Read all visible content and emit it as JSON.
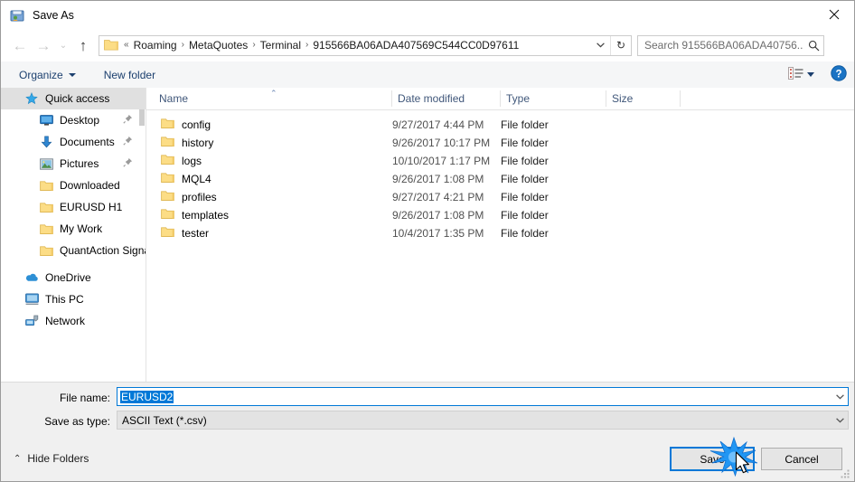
{
  "window": {
    "title": "Save As",
    "icon": "save-as-icon",
    "close_label": "✕"
  },
  "nav": {
    "back": "←",
    "forward": "→",
    "recent": "⌄",
    "up": "↑",
    "breadcrumb_prefix": "«",
    "crumbs": [
      "Roaming",
      "MetaQuotes",
      "Terminal",
      "915566BA06ADA407569C544CC0D97611"
    ],
    "separator": "›",
    "dropdown": "⌄",
    "refresh": "↻"
  },
  "search": {
    "placeholder": "Search 915566BA06ADA40756...",
    "icon": "search-icon"
  },
  "toolbar": {
    "organize": "Organize",
    "new_folder": "New folder",
    "view_icon": "view-layout-icon",
    "help_icon": "help-icon"
  },
  "sidebar": {
    "items": [
      {
        "label": "Quick access",
        "icon": "quick-access-star-icon",
        "selected": true,
        "indent": 0,
        "pinned": false
      },
      {
        "label": "Desktop",
        "icon": "desktop-icon",
        "selected": false,
        "indent": 1,
        "pinned": true
      },
      {
        "label": "Documents",
        "icon": "documents-down-arrow-icon",
        "selected": false,
        "indent": 1,
        "pinned": true
      },
      {
        "label": "Pictures",
        "icon": "pictures-icon",
        "selected": false,
        "indent": 1,
        "pinned": true
      },
      {
        "label": "Downloaded",
        "icon": "folder-icon",
        "selected": false,
        "indent": 1,
        "pinned": false
      },
      {
        "label": "EURUSD H1",
        "icon": "folder-icon",
        "selected": false,
        "indent": 1,
        "pinned": false
      },
      {
        "label": "My Work",
        "icon": "folder-icon",
        "selected": false,
        "indent": 1,
        "pinned": false
      },
      {
        "label": "QuantAction Signal",
        "icon": "folder-icon",
        "selected": false,
        "indent": 1,
        "pinned": false
      },
      {
        "label": "OneDrive",
        "icon": "onedrive-cloud-icon",
        "selected": false,
        "indent": 0,
        "pinned": false
      },
      {
        "label": "This PC",
        "icon": "this-pc-monitor-icon",
        "selected": false,
        "indent": 0,
        "pinned": false
      },
      {
        "label": "Network",
        "icon": "network-icon",
        "selected": false,
        "indent": 0,
        "pinned": false
      }
    ]
  },
  "filelist": {
    "columns": [
      "Name",
      "Date modified",
      "Type",
      "Size"
    ],
    "sort_indicator": "⌃",
    "rows": [
      {
        "name": "config",
        "date": "9/27/2017 4:44 PM",
        "type": "File folder",
        "size": ""
      },
      {
        "name": "history",
        "date": "9/26/2017 10:17 PM",
        "type": "File folder",
        "size": ""
      },
      {
        "name": "logs",
        "date": "10/10/2017 1:17 PM",
        "type": "File folder",
        "size": ""
      },
      {
        "name": "MQL4",
        "date": "9/26/2017 1:08 PM",
        "type": "File folder",
        "size": ""
      },
      {
        "name": "profiles",
        "date": "9/27/2017 4:21 PM",
        "type": "File folder",
        "size": ""
      },
      {
        "name": "templates",
        "date": "9/26/2017 1:08 PM",
        "type": "File folder",
        "size": ""
      },
      {
        "name": "tester",
        "date": "10/4/2017 1:35 PM",
        "type": "File folder",
        "size": ""
      }
    ]
  },
  "form": {
    "filename_label": "File name:",
    "filename_value": "EURUSD2",
    "savetype_label": "Save as type:",
    "savetype_value": "ASCII Text (*.csv)",
    "dropdown_glyph": "⌄"
  },
  "footer": {
    "hide_folders": "Hide Folders",
    "hide_folders_caret": "⌃",
    "save": "Save",
    "cancel": "Cancel"
  },
  "colors": {
    "accent": "#0078d7",
    "selection": "#e0e0e0",
    "chrome": "#f0f0f0",
    "folder_yellow": "#fcdd86",
    "link_blue": "#1b3f6e"
  }
}
